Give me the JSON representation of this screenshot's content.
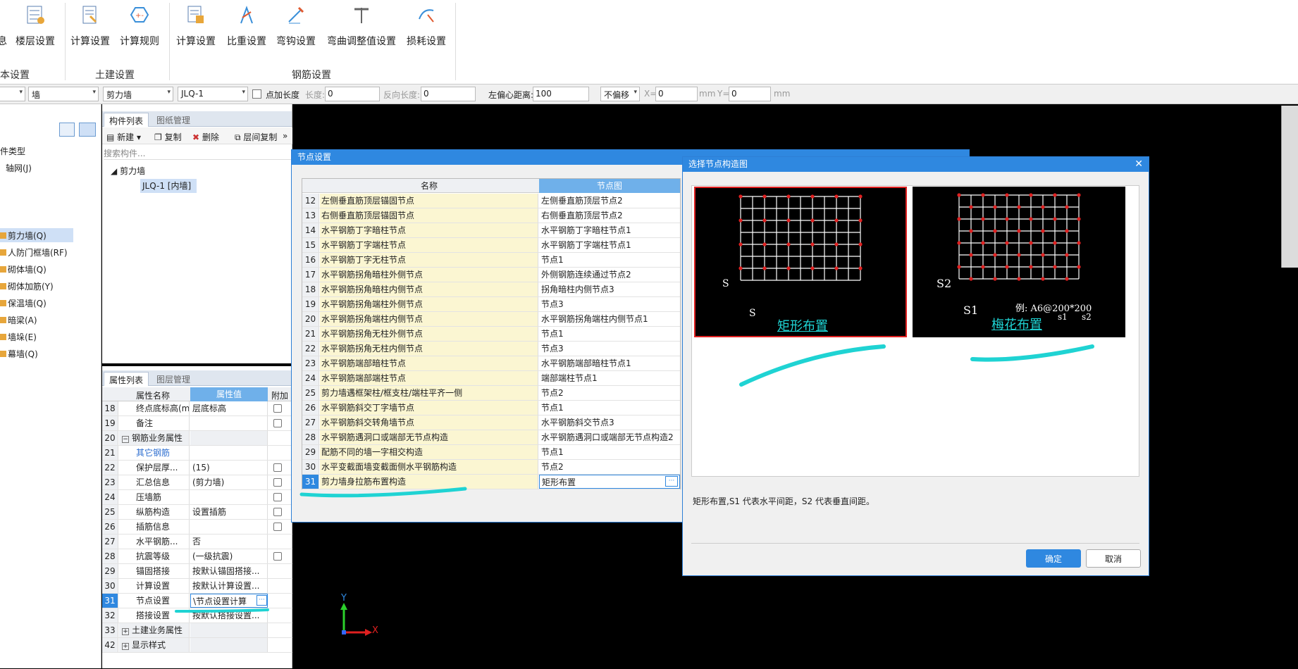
{
  "ribbon": {
    "buttons": [
      {
        "label": "楼层设置",
        "icon": "floor-settings-icon"
      },
      {
        "label": "计算设置",
        "icon": "calc-settings-icon"
      },
      {
        "label": "计算规则",
        "icon": "calc-rules-icon"
      },
      {
        "label": "计算设置",
        "icon": "rebar-calc-settings-icon"
      },
      {
        "label": "比重设置",
        "icon": "density-settings-icon"
      },
      {
        "label": "弯钩设置",
        "icon": "hook-settings-icon"
      },
      {
        "label": "弯曲调整值设置",
        "icon": "bend-adjust-icon"
      },
      {
        "label": "损耗设置",
        "icon": "loss-settings-icon"
      }
    ],
    "cut_label": "息",
    "groups": [
      "本设置",
      "土建设置",
      "钢筋设置"
    ]
  },
  "toolbar": {
    "sel1": "墙",
    "sel2": "剪力墙",
    "sel3": "JLQ-1",
    "add_length_label": "点加长度",
    "length_label": "长度:",
    "length_value": "0",
    "rev_length_label": "反向长度:",
    "rev_length_value": "0",
    "offset_label": "左偏心距离:",
    "offset_value": "100",
    "move_mode": "不偏移",
    "x_label": "X=",
    "x_value": "0",
    "y_label": "Y=",
    "y_value": "0",
    "unit": "mm"
  },
  "leftnav": {
    "type_header": "件类型",
    "items": [
      "轴网(J)",
      "剪力墙(Q)",
      "人防门框墙(RF)",
      "砌体墙(Q)",
      "砌体加筋(Y)",
      "保温墙(Q)",
      "暗梁(A)",
      "墙垛(E)",
      "幕墙(Q)"
    ]
  },
  "component_panel": {
    "tabs": [
      "构件列表",
      "图纸管理"
    ],
    "new_label": "新建",
    "copy_label": "复制",
    "delete_label": "删除",
    "floor_copy_label": "层间复制",
    "search_placeholder": "搜索构件...",
    "tree_root": "剪力墙",
    "tree_child": "JLQ-1 [内墙]"
  },
  "property_panel": {
    "tabs": [
      "属性列表",
      "图层管理"
    ],
    "headers": [
      "属性名称",
      "属性值",
      "附加"
    ],
    "rows": [
      {
        "n": "18",
        "k": "终点底标高(m)",
        "v": "层底标高",
        "cb": true
      },
      {
        "n": "19",
        "k": "备注",
        "v": "",
        "cb": true
      },
      {
        "n": "20",
        "k": "钢筋业务属性",
        "v": "",
        "cb": false,
        "group": true
      },
      {
        "n": "21",
        "k": "其它钢筋",
        "v": "",
        "cb": false,
        "link": true
      },
      {
        "n": "22",
        "k": "保护层厚...",
        "v": "(15)",
        "cb": true
      },
      {
        "n": "23",
        "k": "汇总信息",
        "v": "(剪力墙)",
        "cb": true
      },
      {
        "n": "24",
        "k": "压墙筋",
        "v": "",
        "cb": true
      },
      {
        "n": "25",
        "k": "纵筋构造",
        "v": "设置插筋",
        "cb": true
      },
      {
        "n": "26",
        "k": "插筋信息",
        "v": "",
        "cb": true
      },
      {
        "n": "27",
        "k": "水平钢筋...",
        "v": "否",
        "cb": false
      },
      {
        "n": "28",
        "k": "抗震等级",
        "v": "(一级抗震)",
        "cb": true
      },
      {
        "n": "29",
        "k": "锚固搭接",
        "v": "按默认锚固搭接...",
        "cb": false
      },
      {
        "n": "30",
        "k": "计算设置",
        "v": "按默认计算设置...",
        "cb": false
      },
      {
        "n": "31",
        "k": "节点设置",
        "v": "\\节点设置计算",
        "cb": false,
        "active": true
      },
      {
        "n": "32",
        "k": "搭接设置",
        "v": "按默认搭接设置...",
        "cb": false
      },
      {
        "n": "33",
        "k": "土建业务属性",
        "v": "",
        "cb": false,
        "group": true
      },
      {
        "n": "42",
        "k": "显示样式",
        "v": "",
        "cb": false,
        "group": true
      }
    ]
  },
  "node_dialog": {
    "title": "节点设置",
    "col_name": "名称",
    "col_node": "节点图",
    "rows": [
      {
        "n": "12",
        "k": "左侧垂直筋顶层锚固节点",
        "v": "左侧垂直筋顶层节点2"
      },
      {
        "n": "13",
        "k": "右侧垂直筋顶层锚固节点",
        "v": "右侧垂直筋顶层节点2"
      },
      {
        "n": "14",
        "k": "水平钢筋丁字暗柱节点",
        "v": "水平钢筋丁字暗柱节点1"
      },
      {
        "n": "15",
        "k": "水平钢筋丁字端柱节点",
        "v": "水平钢筋丁字端柱节点1"
      },
      {
        "n": "16",
        "k": "水平钢筋丁字无柱节点",
        "v": "节点1"
      },
      {
        "n": "17",
        "k": "水平钢筋拐角暗柱外侧节点",
        "v": "外侧钢筋连续通过节点2"
      },
      {
        "n": "18",
        "k": "水平钢筋拐角暗柱内侧节点",
        "v": "拐角暗柱内侧节点3"
      },
      {
        "n": "19",
        "k": "水平钢筋拐角端柱外侧节点",
        "v": "节点3"
      },
      {
        "n": "20",
        "k": "水平钢筋拐角端柱内侧节点",
        "v": "水平钢筋拐角端柱内侧节点1"
      },
      {
        "n": "21",
        "k": "水平钢筋拐角无柱外侧节点",
        "v": "节点1"
      },
      {
        "n": "22",
        "k": "水平钢筋拐角无柱内侧节点",
        "v": "节点3"
      },
      {
        "n": "23",
        "k": "水平钢筋端部暗柱节点",
        "v": "水平钢筋端部暗柱节点1"
      },
      {
        "n": "24",
        "k": "水平钢筋端部端柱节点",
        "v": "端部端柱节点1"
      },
      {
        "n": "25",
        "k": "剪力墙遇框架柱/框支柱/端柱平齐一侧",
        "v": "节点2"
      },
      {
        "n": "26",
        "k": "水平钢筋斜交丁字墙节点",
        "v": "节点1"
      },
      {
        "n": "27",
        "k": "水平钢筋斜交转角墙节点",
        "v": "水平钢筋斜交节点3"
      },
      {
        "n": "28",
        "k": "水平钢筋遇洞口或端部无节点构造",
        "v": "水平钢筋遇洞口或端部无节点构造2"
      },
      {
        "n": "29",
        "k": "配筋不同的墙一字相交构造",
        "v": "节点1"
      },
      {
        "n": "30",
        "k": "水平变截面墙变截面侧水平钢筋构造",
        "v": "节点2"
      },
      {
        "n": "31",
        "k": "剪力墙身拉筋布置构造",
        "v": "矩形布置",
        "active": true
      }
    ]
  },
  "select_dialog": {
    "title": "选择节点构造图",
    "option1": "矩形布置",
    "option2": "梅花布置",
    "example": "例: A6@200*200",
    "s_label": "S",
    "s1_label": "S1",
    "s2_label": "S2",
    "s1_small": "s1",
    "s2_small": "s2",
    "description": "矩形布置,S1 代表水平间距，S2 代表垂直间距。",
    "ok": "确定",
    "cancel": "取消"
  },
  "axis": {
    "x": "X",
    "y": "Y"
  },
  "colors": {
    "accent": "#2f88e0",
    "highlight_row": "#fbf6d2",
    "red_border": "#e02020",
    "cyan": "#1fd3d3"
  }
}
